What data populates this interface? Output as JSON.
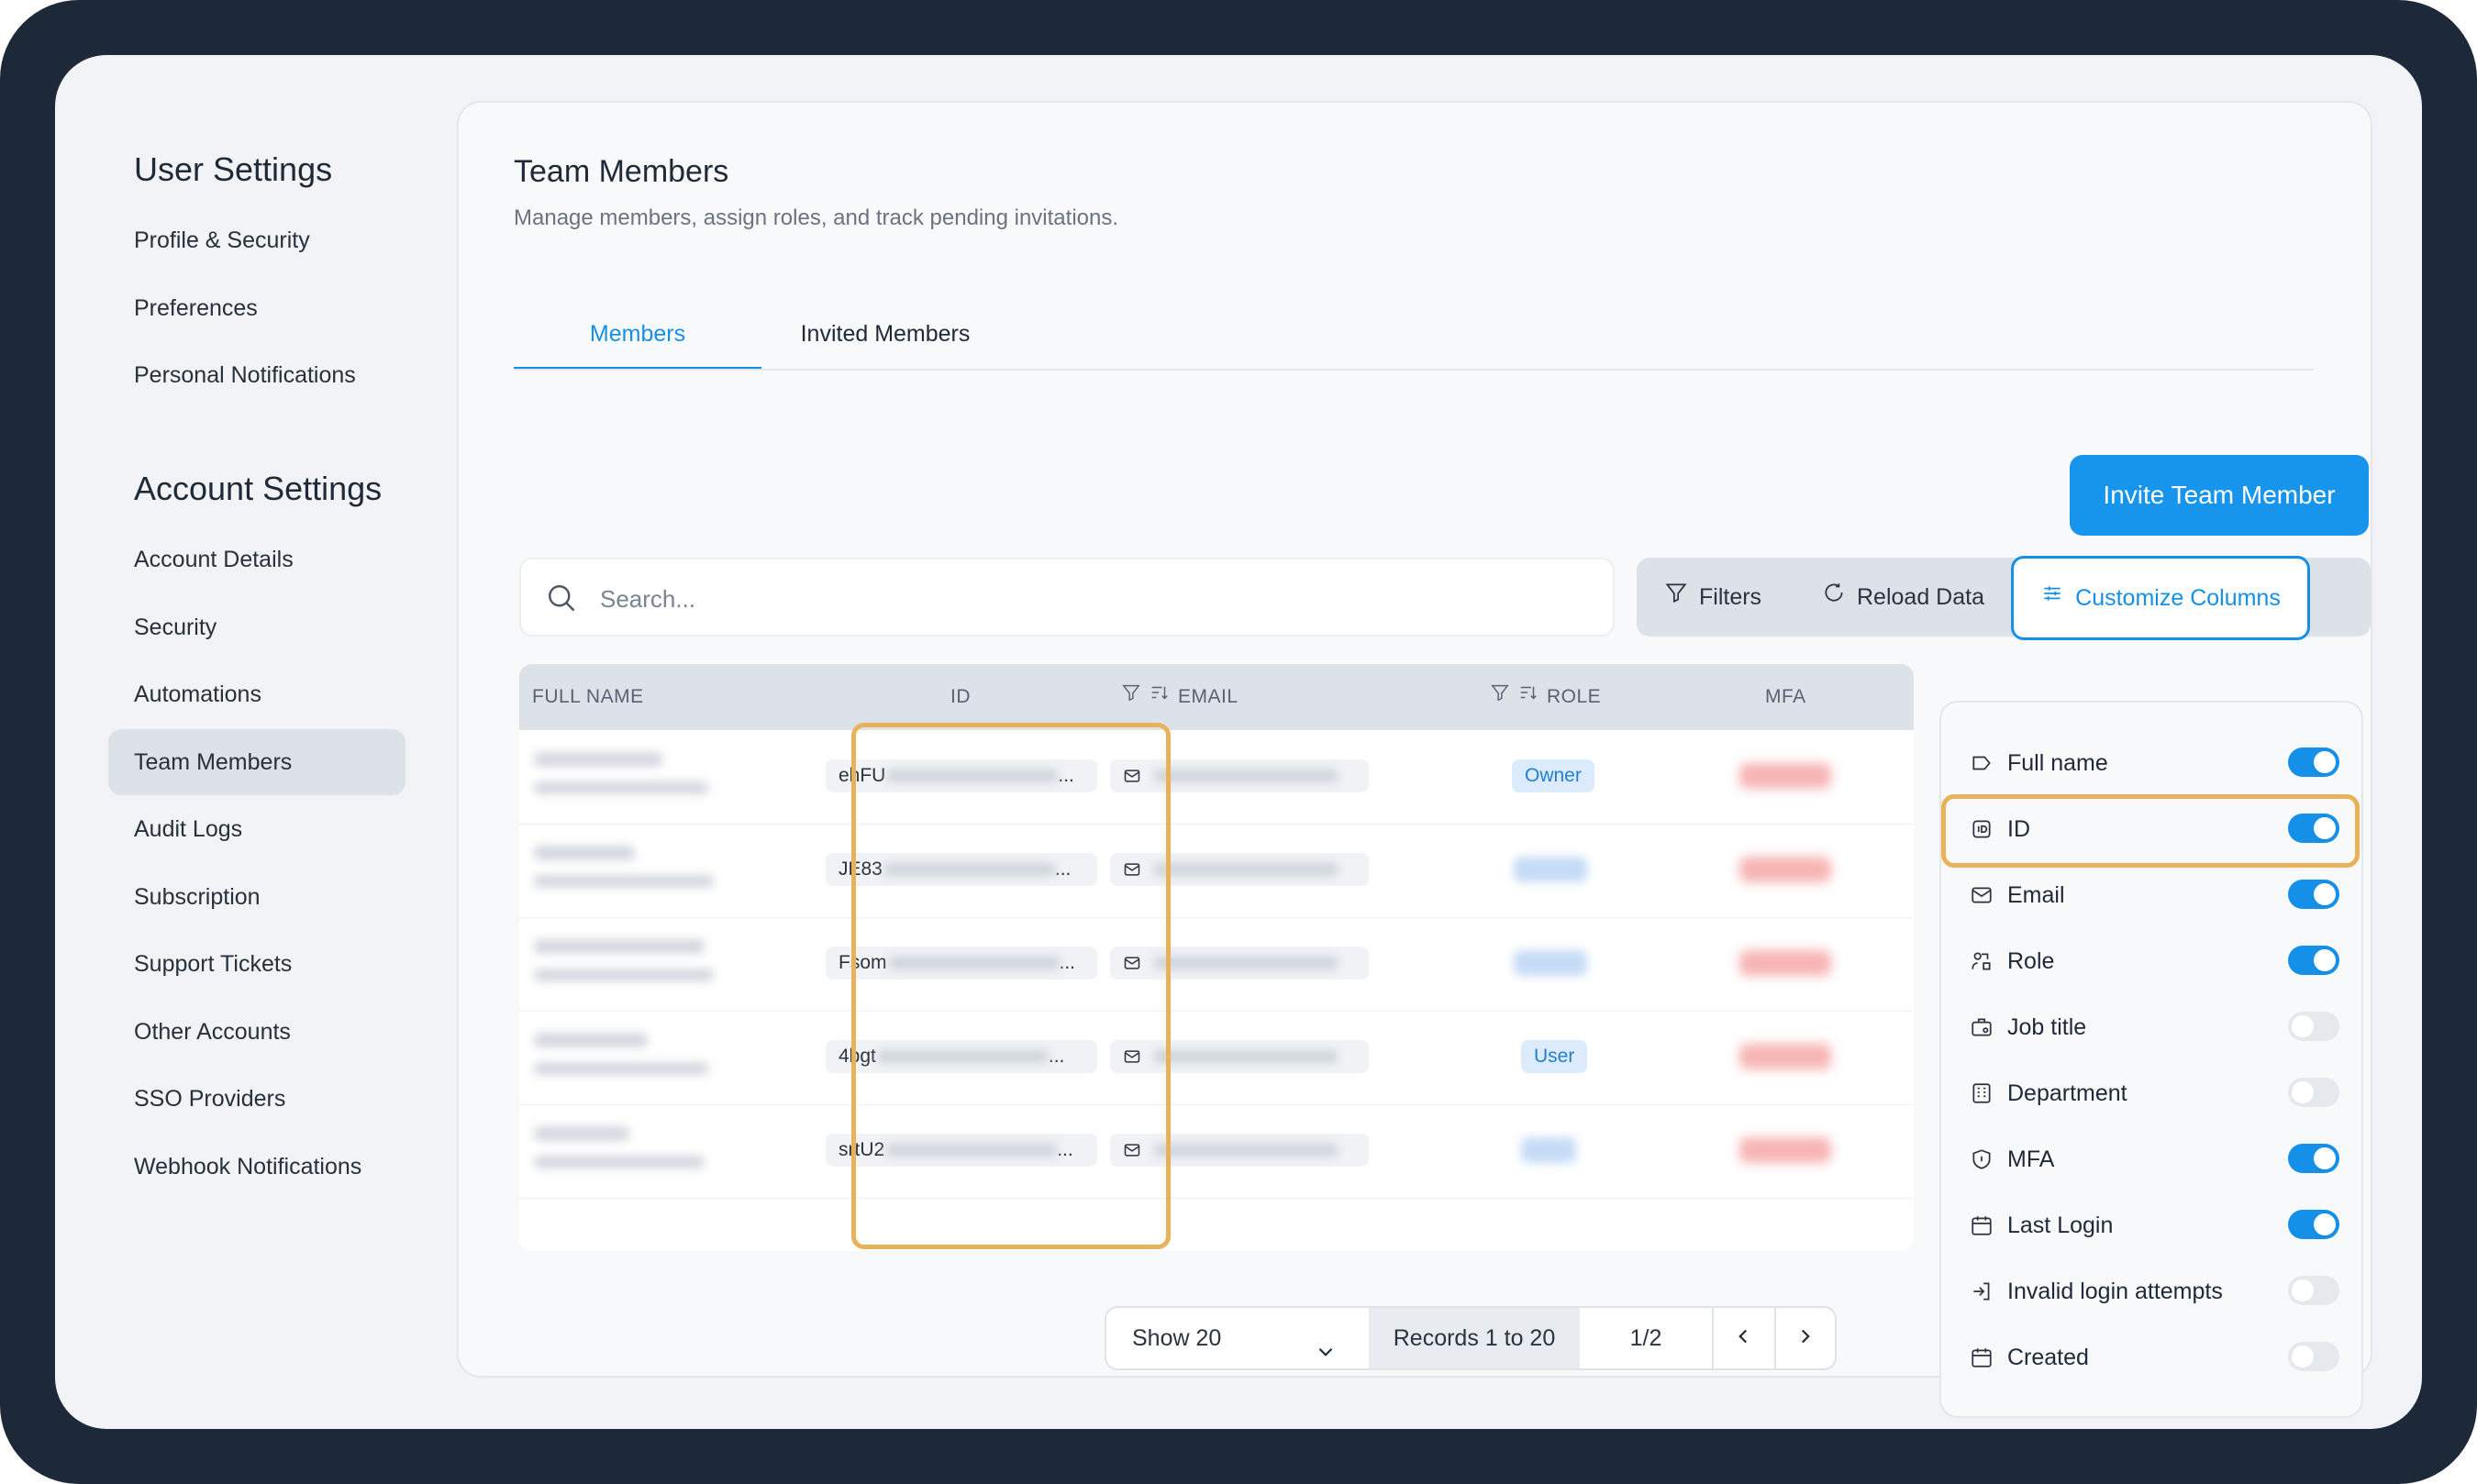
{
  "sidebar": {
    "user_settings_title": "User Settings",
    "user_items": [
      "Profile & Security",
      "Preferences",
      "Personal Notifications"
    ],
    "account_settings_title": "Account Settings",
    "account_items": [
      "Account Details",
      "Security",
      "Automations",
      "Team Members",
      "Audit Logs",
      "Subscription",
      "Support Tickets",
      "Other Accounts",
      "SSO Providers",
      "Webhook Notifications"
    ],
    "active_item": "Team Members"
  },
  "page": {
    "title": "Team Members",
    "subtitle": "Manage members, assign roles, and track pending invitations."
  },
  "tabs": [
    {
      "label": "Members",
      "active": true
    },
    {
      "label": "Invited Members",
      "active": false
    }
  ],
  "invite_button": "Invite Team Member",
  "search": {
    "placeholder": "Search..."
  },
  "toolbar": {
    "filters": "Filters",
    "reload": "Reload Data",
    "customize": "Customize Columns"
  },
  "table": {
    "headers": {
      "full_name": "FULL NAME",
      "id": "ID",
      "email": "EMAIL",
      "role": "ROLE",
      "mfa": "MFA"
    },
    "rows": [
      {
        "id_prefix": "ehFU",
        "role": "Owner",
        "role_visible": true
      },
      {
        "id_prefix": "JE83",
        "role": "",
        "role_visible": false
      },
      {
        "id_prefix": "Fsom",
        "role": "",
        "role_visible": false
      },
      {
        "id_prefix": "4bgt",
        "role": "User",
        "role_visible": true
      },
      {
        "id_prefix": "srtU2",
        "role": "",
        "role_visible": false
      }
    ],
    "ellipsis": "..."
  },
  "pagination": {
    "show": "Show 20",
    "records": "Records 1 to 20",
    "page": "1/2"
  },
  "customize_panel": {
    "options": [
      {
        "label": "Full name",
        "icon": "tag-icon",
        "enabled": true
      },
      {
        "label": "ID",
        "icon": "id-card-icon",
        "enabled": true
      },
      {
        "label": "Email",
        "icon": "mail-icon",
        "enabled": true
      },
      {
        "label": "Role",
        "icon": "role-icon",
        "enabled": true
      },
      {
        "label": "Job title",
        "icon": "briefcase-icon",
        "enabled": false
      },
      {
        "label": "Department",
        "icon": "building-icon",
        "enabled": false
      },
      {
        "label": "MFA",
        "icon": "shield-icon",
        "enabled": true
      },
      {
        "label": "Last Login",
        "icon": "calendar-icon",
        "enabled": true
      },
      {
        "label": "Invalid login attempts",
        "icon": "login-icon",
        "enabled": false
      },
      {
        "label": "Created",
        "icon": "calendar-icon",
        "enabled": false
      }
    ],
    "highlighted_option": "ID"
  },
  "colors": {
    "accent": "#1590e8",
    "highlight": "#e8b25a",
    "frame": "#1d2939"
  }
}
